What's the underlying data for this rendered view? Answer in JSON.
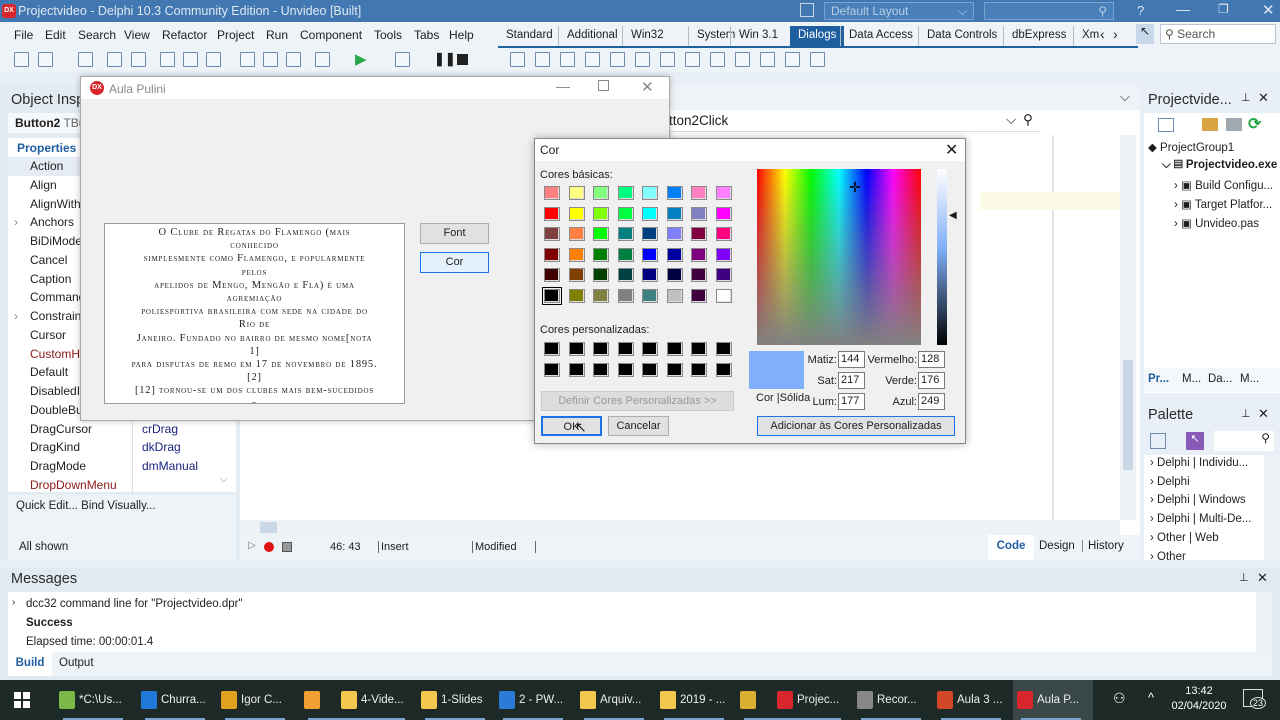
{
  "titlebar": {
    "title": "Projectvideo - Delphi 10.3 Community Edition - Unvideo [Built]",
    "layout": "Default Layout",
    "search_placeholder": "",
    "help": "?"
  },
  "menu": [
    "File",
    "Edit",
    "Search",
    "View",
    "Refactor",
    "Project",
    "Run",
    "Component",
    "Tools",
    "Tabs",
    "Help"
  ],
  "component_tabs": [
    "Standard",
    "Additional",
    "Win32",
    "System",
    "Win 3.1",
    "Dialogs",
    "Data Access",
    "Data Controls",
    "dbExpress",
    "Xm"
  ],
  "component_tab_active": "Dialogs",
  "palette_search_placeholder": "Search",
  "object_inspector": {
    "title": "Object Insp",
    "selected": "Button2",
    "type": "TBu",
    "section": "Properties",
    "properties": [
      {
        "name": "Action"
      },
      {
        "name": "Align"
      },
      {
        "name": "AlignWith"
      },
      {
        "name": "Anchors",
        "expandable": true
      },
      {
        "name": "BiDiMode"
      },
      {
        "name": "Cancel"
      },
      {
        "name": "Caption"
      },
      {
        "name": "Command"
      },
      {
        "name": "Constraint",
        "expandable": true
      },
      {
        "name": "Cursor"
      },
      {
        "name": "CustomHi",
        "highlight": true
      },
      {
        "name": "Default"
      },
      {
        "name": "DisabledIn"
      },
      {
        "name": "DoubleBut"
      },
      {
        "name": "DragCursor",
        "value": "crDrag"
      },
      {
        "name": "DragKind",
        "value": "dkDrag"
      },
      {
        "name": "DragMode",
        "value": "dmManual"
      },
      {
        "name": "DropDownMenu",
        "highlight": true
      }
    ],
    "quick_edit": "Quick Edit...  Bind Visually...",
    "filter": "All shown"
  },
  "form": {
    "title": "Aula Pulini",
    "memo_lines": [
      "O Clube de Regatas do Flamengo (mais",
      "conhecido",
      "simplesmente como Flamengo, e popularmente",
      "pelos",
      "apelidos de Mengo, Mengão e Fla) é uma",
      "agremiação",
      "poliesportiva brasileira com sede na cidade do",
      "Rio de",
      "Janeiro. Fundado no bairro de mesmo nome[nota",
      "1]",
      "para disputas de remo em 17 de novembro de 1895.",
      "[2]",
      "[12] tornou-se um dos clubes mais bem-sucedidos",
      "e"
    ],
    "font_button": "Font",
    "cor_button": "Cor"
  },
  "editor": {
    "method": "tton2Click",
    "position": "46: 43",
    "mode": "Insert",
    "state": "Modified",
    "tabs": [
      "Code",
      "Design",
      "History"
    ],
    "active_tab": "Code"
  },
  "color_dialog": {
    "title": "Cor",
    "basic_label": "Cores básicas:",
    "custom_label": "Cores personalizadas:",
    "basic_colors": [
      "#ff8080",
      "#ffff80",
      "#80ff80",
      "#00ff80",
      "#80ffff",
      "#0080ff",
      "#ff80c0",
      "#ff80ff",
      "#ff0000",
      "#ffff00",
      "#80ff00",
      "#00ff40",
      "#00ffff",
      "#0080c0",
      "#8080c0",
      "#ff00ff",
      "#804040",
      "#ff8040",
      "#00ff00",
      "#008080",
      "#004080",
      "#8080ff",
      "#800040",
      "#ff0080",
      "#800000",
      "#ff8000",
      "#008000",
      "#008040",
      "#0000ff",
      "#0000a0",
      "#800080",
      "#8000ff",
      "#400000",
      "#804000",
      "#004000",
      "#004040",
      "#000080",
      "#000040",
      "#400040",
      "#400080",
      "#000000",
      "#808000",
      "#808040",
      "#808080",
      "#408080",
      "#c0c0c0",
      "#400040",
      "#ffffff"
    ],
    "selected_basic": "#000000",
    "custom_colors": [
      "#000000",
      "#000000",
      "#000000",
      "#000000",
      "#000000",
      "#000000",
      "#000000",
      "#000000",
      "#000000",
      "#000000",
      "#000000",
      "#000000",
      "#000000",
      "#000000",
      "#000000",
      "#000000"
    ],
    "define_button": "Definir Cores Personalizadas >>",
    "ok_button": "OK",
    "cancel_button": "Cancelar",
    "add_button": "Adicionar às Cores Personalizadas",
    "preview_label": "Cor |Sólida",
    "current_color": "#80b0f9",
    "hue_label": "Matiz:",
    "hue": "144",
    "sat_label": "Sat:",
    "sat": "217",
    "lum_label": "Lum:",
    "lum": "177",
    "red_label": "Vermelho:",
    "red": "128",
    "green_label": "Verde:",
    "green": "176",
    "blue_label": "Azul:",
    "blue": "249"
  },
  "project_manager": {
    "title": "Projectvide...",
    "tree": [
      {
        "label": "ProjectGroup1"
      },
      {
        "label": "Projectvideo.exe",
        "bold": true
      },
      {
        "label": "Build Configu..."
      },
      {
        "label": "Target Platfor..."
      },
      {
        "label": "Unvideo.pas"
      }
    ],
    "tabs": [
      "Pr...",
      "M...",
      "Da...",
      "M..."
    ]
  },
  "palette": {
    "title": "Palette",
    "items": [
      "Delphi | Individu...",
      "Delphi",
      "Delphi | Windows",
      "Delphi | Multi-De...",
      "Other | Web",
      "Other"
    ]
  },
  "messages": {
    "title": "Messages",
    "lines": [
      "dcc32 command line for \"Projectvideo.dpr\"",
      "Success",
      "Elapsed time: 00:00:01.4"
    ],
    "tabs": [
      "Build",
      "Output"
    ]
  },
  "taskbar": {
    "items": [
      {
        "label": "*C:\\Us...",
        "color": "#7bb84a"
      },
      {
        "label": "Churra...",
        "color": "#1f7ad8"
      },
      {
        "label": "Igor C...",
        "color": "#e0a020"
      },
      {
        "label": "",
        "color": "#f0a030"
      },
      {
        "label": "4-Vide...",
        "color": "#f2c94c"
      },
      {
        "label": "1-Slides",
        "color": "#f2c94c"
      },
      {
        "label": "2 - PW...",
        "color": "#2a7ad8"
      },
      {
        "label": "Arquiv...",
        "color": "#f2c94c"
      },
      {
        "label": "2019 - ...",
        "color": "#f2c94c"
      },
      {
        "label": "",
        "color": "#d9b030"
      },
      {
        "label": "Projec...",
        "color": "#d9262c"
      },
      {
        "label": "Recor...",
        "color": "#888888"
      },
      {
        "label": "Aula 3 ...",
        "color": "#d24726"
      },
      {
        "label": "Aula P...",
        "color": "#d9262c"
      }
    ],
    "time": "13:42",
    "date": "02/04/2020",
    "notifications": "23"
  }
}
